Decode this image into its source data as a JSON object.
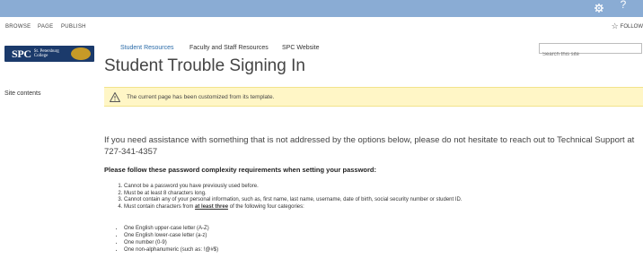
{
  "suite_bar": {
    "icons": [
      "gear-icon",
      "help-icon"
    ],
    "help_glyph": "?"
  },
  "ribbon": {
    "tabs": [
      "BROWSE",
      "PAGE",
      "PUBLISH"
    ],
    "follow_label": "FOLLOW"
  },
  "logo": {
    "mark": "SPC",
    "subtitle": "St. Petersburg College"
  },
  "top_nav": [
    "Student Resources",
    "Faculty and Staff Resources",
    "SPC Website"
  ],
  "search": {
    "placeholder": "Search this site"
  },
  "page_title": "Student Trouble Signing In",
  "quick_launch": {
    "site_contents": "Site contents"
  },
  "status_bar": {
    "message": "The current page has been customized from its template."
  },
  "content": {
    "intro": "If you need assistance with something that is not addressed by the options below, please do not hesitate to reach out to Technical Support at 727-341-4357",
    "requirements_heading": "Please follow these password complexity requirements when setting your password:",
    "rules": [
      "Cannot be a password you have previously used before.",
      "Must be at least 8 characters long.",
      "Cannot contain any of your personal information, such as, first name, last name, username, date of birth, social security number or student ID."
    ],
    "rule4_prefix": "Must contain characters from ",
    "rule4_emphasis": "at least three",
    "rule4_suffix": " of the following four categories:",
    "categories": [
      "One English upper-case letter (A-Z)",
      "One English lower-case letter (a-z)",
      "One number (0-9)",
      "One non-alphanumeric (such as: !@#$)"
    ]
  },
  "colors": {
    "suite_bar": "#8aacd4",
    "logo_background": "#1b3a6b",
    "nav_active": "#2a6ba8",
    "status_background": "#fff6c6"
  }
}
